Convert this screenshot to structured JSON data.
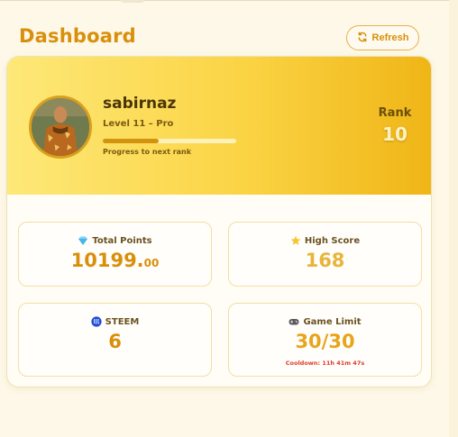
{
  "page": {
    "title": "Dashboard"
  },
  "toolbar": {
    "refresh_label": "Refresh",
    "refresh_icon": "refresh-icon"
  },
  "profile": {
    "username": "sabirnaz",
    "level_text": "Level 11 – Pro",
    "progress_label": "Progress to next rank",
    "progress_fraction": 0.42,
    "rank_label": "Rank",
    "rank_value": "10"
  },
  "stats": {
    "total_points": {
      "label": "Total Points",
      "icon": "gem-icon",
      "value_main": "10199.",
      "value_decimals": "00",
      "color": "#d98f0b"
    },
    "high_score": {
      "label": "High Score",
      "icon": "star-icon",
      "value": "168",
      "color": "#e8b53a"
    },
    "steem": {
      "label": "STEEM",
      "icon": "steem-logo-icon",
      "value": "6",
      "color": "#d98f0b"
    },
    "game_limit": {
      "label": "Game Limit",
      "icon": "gamepad-icon",
      "value": "30/30",
      "cooldown": "Cooldown: 11h 41m 47s",
      "color": "#e8a51c"
    }
  },
  "colors": {
    "accent": "#d98f0b",
    "cooldown": "#e23a2a"
  }
}
